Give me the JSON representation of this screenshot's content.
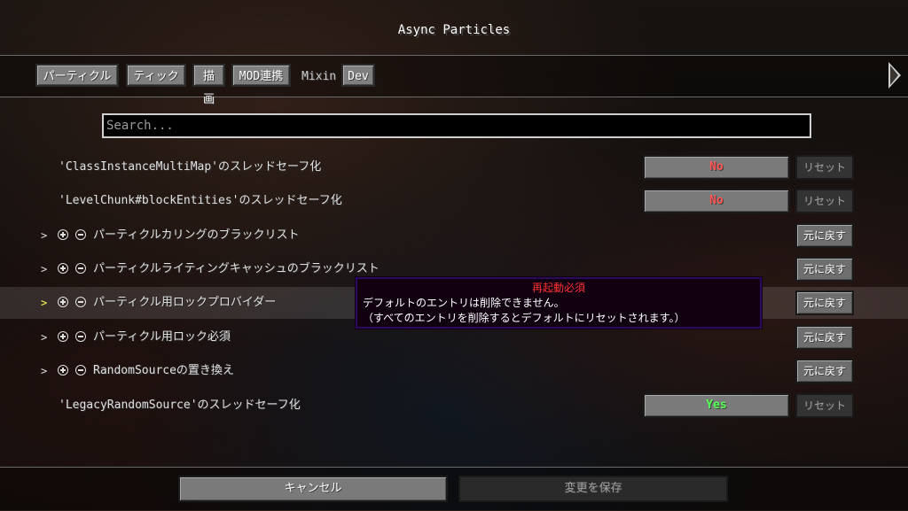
{
  "window": {
    "title": "Async Particles"
  },
  "tabs": [
    {
      "label": "パーティクル",
      "active": false
    },
    {
      "label": "ティック",
      "active": false
    },
    {
      "label": "描画",
      "active": false
    },
    {
      "label": "MOD連携",
      "active": false
    },
    {
      "label": "Mixin",
      "active": true
    },
    {
      "label": "Dev",
      "active": false
    }
  ],
  "search": {
    "placeholder": "Search..."
  },
  "rows": [
    {
      "label": "'ClassInstanceMultiMap'のスレッドセーフ化",
      "value": "No",
      "reset": "リセット"
    },
    {
      "label": "'LevelChunk#blockEntities'のスレッドセーフ化",
      "value": "No",
      "reset": "リセット"
    },
    {
      "label": "パーティクルカリングのブラックリスト",
      "restore": "元に戻す"
    },
    {
      "label": "パーティクルライティングキャッシュのブラックリスト",
      "restore": "元に戻す"
    },
    {
      "label": "パーティクル用ロックプロバイダー",
      "restore": "元に戻す"
    },
    {
      "label": "パーティクル用ロック必須",
      "restore": "元に戻す"
    },
    {
      "label": "RandomSourceの置き換え",
      "restore": "元に戻す"
    },
    {
      "label": "'LegacyRandomSource'のスレッドセーフ化",
      "value": "Yes",
      "reset": "リセット"
    }
  ],
  "tooltip": {
    "title": "再起動必須",
    "line1": "デフォルトのエントリは削除できません。",
    "line2": "（すべてのエントリを削除するとデフォルトにリセットされます。）"
  },
  "footer": {
    "cancel_label": "キャンセル",
    "save_label": "変更を保存"
  },
  "colors": {
    "no": "#ff5555",
    "yes": "#55ff55",
    "tooltip_title": "#ff3333",
    "tooltip_border": "#2a0b60"
  }
}
